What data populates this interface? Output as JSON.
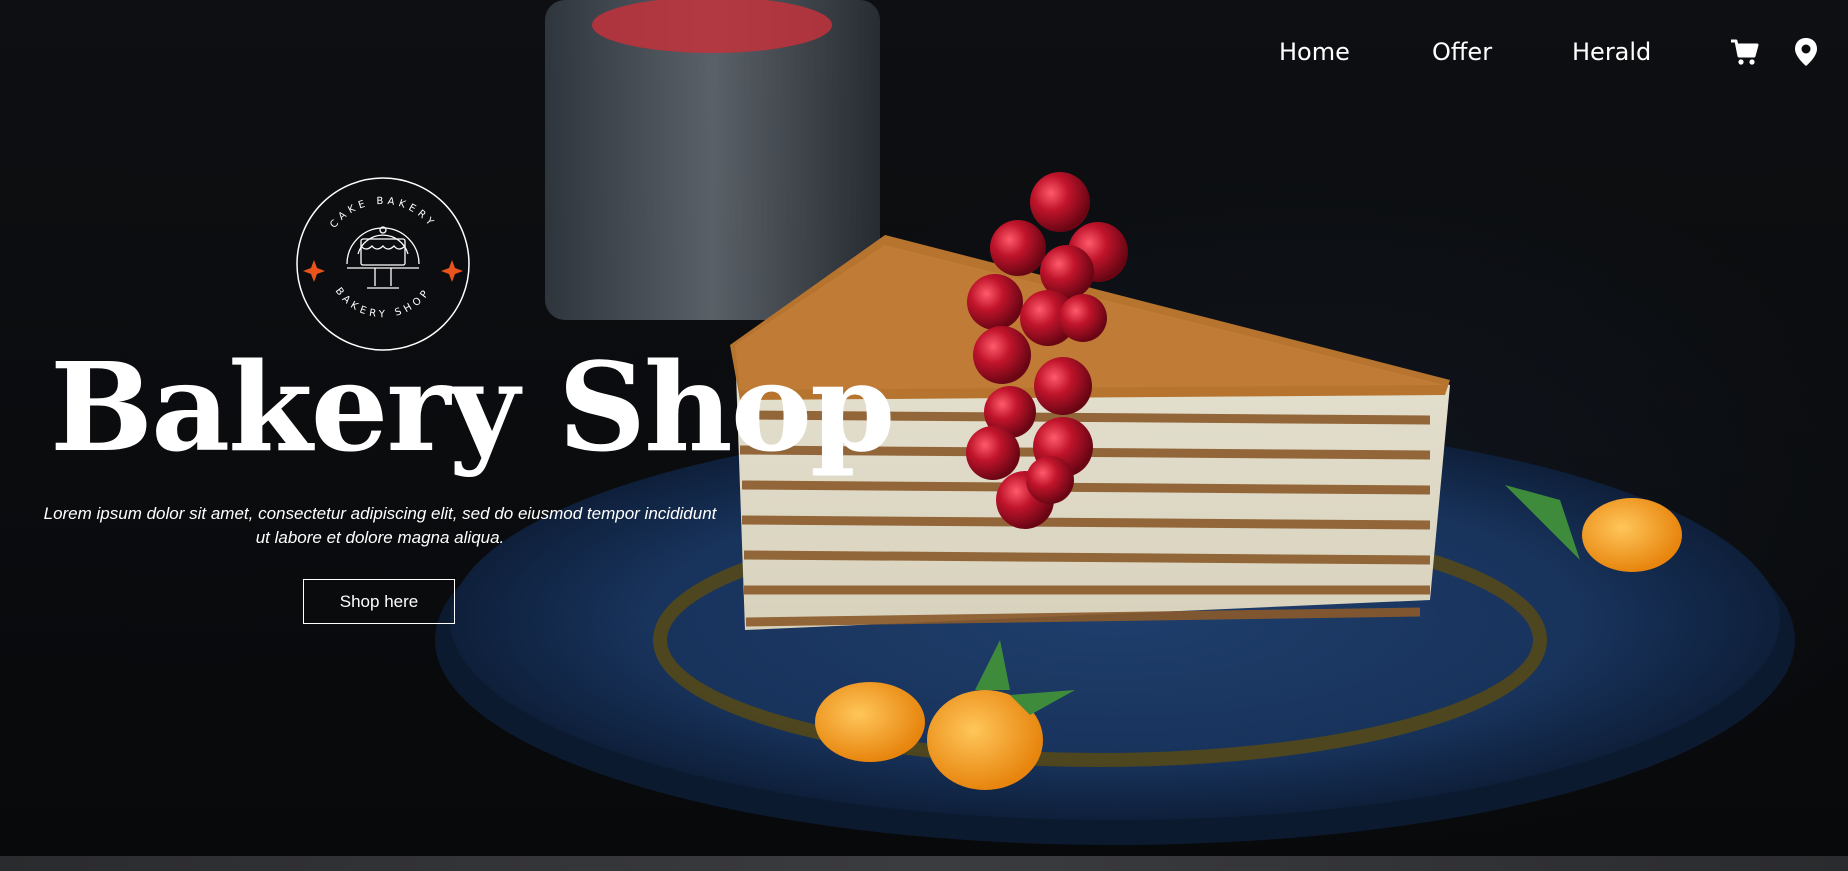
{
  "nav": {
    "items": [
      {
        "label": "Home"
      },
      {
        "label": "Offer"
      },
      {
        "label": "Herald"
      }
    ],
    "cart_icon": "shopping-cart-icon",
    "location_icon": "map-pin-icon"
  },
  "logo": {
    "top_text": "CAKE BAKERY",
    "bottom_text": "BAKERY SHOP",
    "accent_color": "#e8541c"
  },
  "hero": {
    "title": "Bakery Shop",
    "subtitle": "Lorem ipsum dolor sit amet, consectetur adipiscing elit, sed do eiusmod tempor incididunt ut labore et dolore magna aliqua.",
    "cta_label": "Shop here"
  },
  "colors": {
    "background": "#0a0b0d",
    "plate_blue": "#1c3760",
    "text": "#ffffff"
  }
}
